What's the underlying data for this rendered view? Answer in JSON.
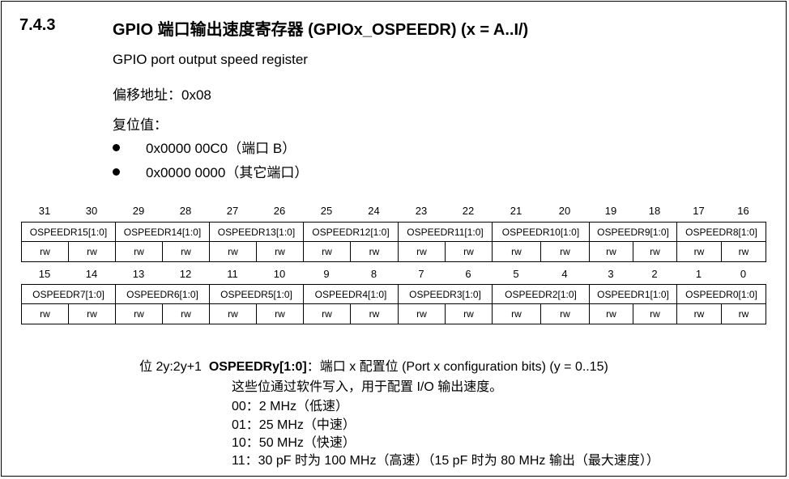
{
  "section": {
    "number": "7.4.3",
    "title": "GPIO 端口输出速度寄存器 (GPIOx_OSPEEDR) (x = A..I/)"
  },
  "subtitle": "GPIO port output speed register",
  "offset": "偏移地址：0x08",
  "reset": {
    "label": "复位值：",
    "items": [
      "0x0000 00C0（端口 B）",
      "0x0000 0000（其它端口）"
    ]
  },
  "register": {
    "high_bits": [
      "31",
      "30",
      "29",
      "28",
      "27",
      "26",
      "25",
      "24",
      "23",
      "22",
      "21",
      "20",
      "19",
      "18",
      "17",
      "16"
    ],
    "low_bits": [
      "15",
      "14",
      "13",
      "12",
      "11",
      "10",
      "9",
      "8",
      "7",
      "6",
      "5",
      "4",
      "3",
      "2",
      "1",
      "0"
    ],
    "high_fields": [
      "OSPEEDR15[1:0]",
      "OSPEEDR14[1:0]",
      "OSPEEDR13[1:0]",
      "OSPEEDR12[1:0]",
      "OSPEEDR11[1:0]",
      "OSPEEDR10[1:0]",
      "OSPEEDR9[1:0]",
      "OSPEEDR8[1:0]"
    ],
    "low_fields": [
      "OSPEEDR7[1:0]",
      "OSPEEDR6[1:0]",
      "OSPEEDR5[1:0]",
      "OSPEEDR4[1:0]",
      "OSPEEDR3[1:0]",
      "OSPEEDR2[1:0]",
      "OSPEEDR1[1:0]",
      "OSPEEDR0[1:0]"
    ],
    "access": "rw"
  },
  "description": {
    "bits": "位 2y:2y+1",
    "field": "OSPEEDRy[1:0]",
    "field_desc": "：端口 x 配置位 (Port x configuration bits) (y = 0..15)",
    "line1": "这些位通过软件写入，用于配置 I/O 输出速度。",
    "opt00": "00：2 MHz（低速）",
    "opt01": "01：25 MHz（中速）",
    "opt10": "10：50 MHz（快速）",
    "opt11": "11：30 pF 时为 100 MHz（高速）（15 pF 时为 80 MHz 输出（最大速度））"
  }
}
